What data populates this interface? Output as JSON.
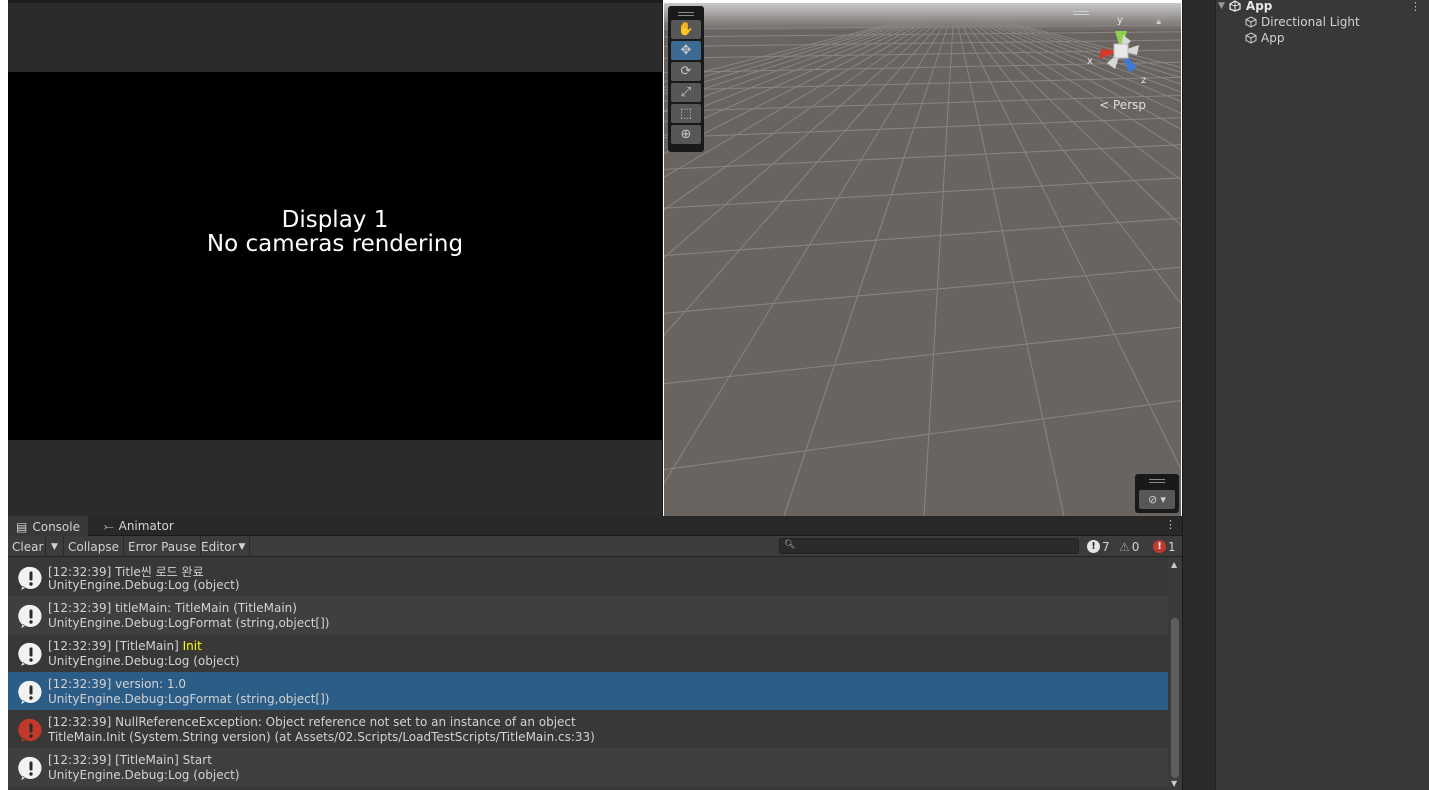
{
  "game_view": {
    "line1": "Display 1",
    "line2": "No cameras rendering"
  },
  "scene_view": {
    "persp_label": "Persp",
    "gizmo_axes": {
      "y": "y",
      "x": "x",
      "z": "z"
    },
    "tools": [
      "hand-icon",
      "move-icon",
      "rotate-icon",
      "scale-icon",
      "rect-icon",
      "transform-icon"
    ],
    "active_tool": "move-icon"
  },
  "hierarchy": {
    "root": "App",
    "children": [
      "Directional Light",
      "App"
    ]
  },
  "console": {
    "tabs": [
      {
        "label": "Console",
        "icon": "console-icon"
      },
      {
        "label": "Animator",
        "icon": "animator-icon"
      }
    ],
    "toolbar": {
      "clear": "Clear",
      "collapse": "Collapse",
      "error_pause": "Error Pause",
      "editor": "Editor"
    },
    "counts": {
      "info": "7",
      "warning": "0",
      "error": "1"
    },
    "entries": [
      {
        "type": "info",
        "line1": "[12:32:39] Title씬 로드 완료",
        "line2": "UnityEngine.Debug:Log (object)"
      },
      {
        "type": "info",
        "line1": "[12:32:39] titleMain: TitleMain (TitleMain)",
        "line2": "UnityEngine.Debug:LogFormat (string,object[])"
      },
      {
        "type": "info",
        "line1_prefix": "[12:32:39] [TitleMain] ",
        "line1_highlight": "Init",
        "line2": "UnityEngine.Debug:Log (object)"
      },
      {
        "type": "info",
        "selected": true,
        "line1": "[12:32:39] version: 1.0",
        "line2": "UnityEngine.Debug:LogFormat (string,object[])"
      },
      {
        "type": "error",
        "line1": "[12:32:39] NullReferenceException: Object reference not set to an instance of an object",
        "line2": "TitleMain.Init (System.String version) (at Assets/02.Scripts/LoadTestScripts/TitleMain.cs:33)"
      },
      {
        "type": "info",
        "line1": "[12:32:39] [TitleMain] Start",
        "line2": "UnityEngine.Debug:Log (object)"
      }
    ]
  },
  "colors": {
    "selected_row": "#2c5d87",
    "highlight_text": "#ffff00",
    "error_icon": "#c0392b"
  }
}
